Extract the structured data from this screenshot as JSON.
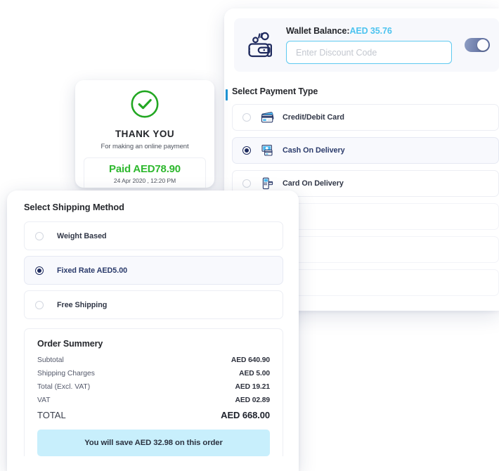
{
  "wallet": {
    "icon": "wallet-icon",
    "balance_label": "Wallet Balance:",
    "balance_amount": "AED 35.76",
    "discount_placeholder": "Enter Discount Code",
    "discount_value": "",
    "toggle_state": "on",
    "accent_color": "#4cc3ef"
  },
  "payment": {
    "title": "Select Payment Type",
    "options": [
      {
        "label": "Credit/Debit Card",
        "icon": "credit-card-icon",
        "selected": false
      },
      {
        "label": "Cash On Delivery",
        "icon": "cash-delivery-icon",
        "selected": true
      },
      {
        "label": "Card On Delivery",
        "icon": "card-reader-icon",
        "selected": false
      }
    ]
  },
  "thankyou": {
    "icon": "check-circle-icon",
    "title": "THANK YOU",
    "subtitle": "For making an online payment",
    "paid_amount": "Paid AED78.90",
    "paid_datetime": "24 Apr 2020 , 12:20 PM",
    "success_color": "#2eb82e"
  },
  "shipping": {
    "title": "Select Shipping Method",
    "options": [
      {
        "label": "Weight Based",
        "selected": false
      },
      {
        "label": "Fixed Rate AED5.00",
        "selected": true
      },
      {
        "label": "Free Shipping",
        "selected": false
      }
    ]
  },
  "summary": {
    "title": "Order Summery",
    "rows": [
      {
        "label": "Subtotal",
        "value": "AED 640.90"
      },
      {
        "label": "Shipping Charges",
        "value": "AED 5.00"
      },
      {
        "label": "Total (Excl. VAT)",
        "value": "AED 19.21"
      },
      {
        "label": "VAT",
        "value": "AED 02.89"
      }
    ],
    "total_label": "TOTAL",
    "total_value": "AED 668.00",
    "savings_banner": "You will save AED 32.98 on this order",
    "savings_bg": "#c8effc"
  }
}
